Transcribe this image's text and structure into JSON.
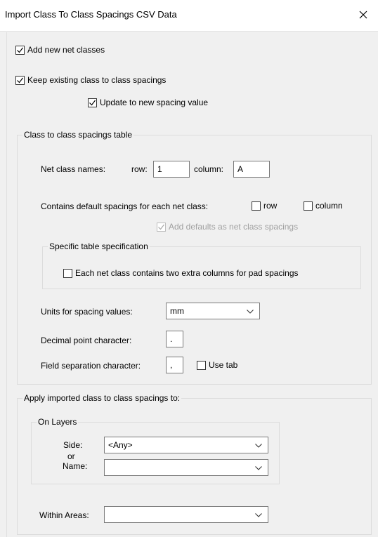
{
  "window": {
    "title": "Import Class To Class Spacings CSV Data",
    "close_icon": "close-icon"
  },
  "options": {
    "add_new_net_classes": {
      "label": "Add new net classes",
      "checked": true
    },
    "keep_existing": {
      "label": "Keep existing class to class spacings",
      "checked": true
    },
    "update_spacing": {
      "label": "Update to new spacing value",
      "checked": true
    }
  },
  "table_group": {
    "legend": "Class to class spacings table",
    "net_class_names_label": "Net class names:",
    "row_label": "row:",
    "row_value": "1",
    "column_label": "column:",
    "column_value": "A",
    "default_spacings_label": "Contains default spacings for each net class:",
    "default_row_label": "row",
    "default_column_label": "column",
    "add_defaults_label": "Add defaults as net class spacings",
    "specific_legend": "Specific table specification",
    "extra_columns_label": "Each net class contains two extra columns for pad spacings",
    "units_label": "Units for spacing values:",
    "units_value": "mm",
    "decimal_label": "Decimal point character:",
    "decimal_value": ".",
    "separator_label": "Field separation character:",
    "separator_value": ",",
    "use_tab_label": "Use tab"
  },
  "apply_group": {
    "legend": "Apply imported class to class spacings to:",
    "layers_legend": "On Layers",
    "side_label": "Side:",
    "or_label": "or",
    "name_label": "Name:",
    "side_value": "<Any>",
    "name_value": "",
    "within_areas_label": "Within Areas:",
    "within_areas_value": ""
  }
}
